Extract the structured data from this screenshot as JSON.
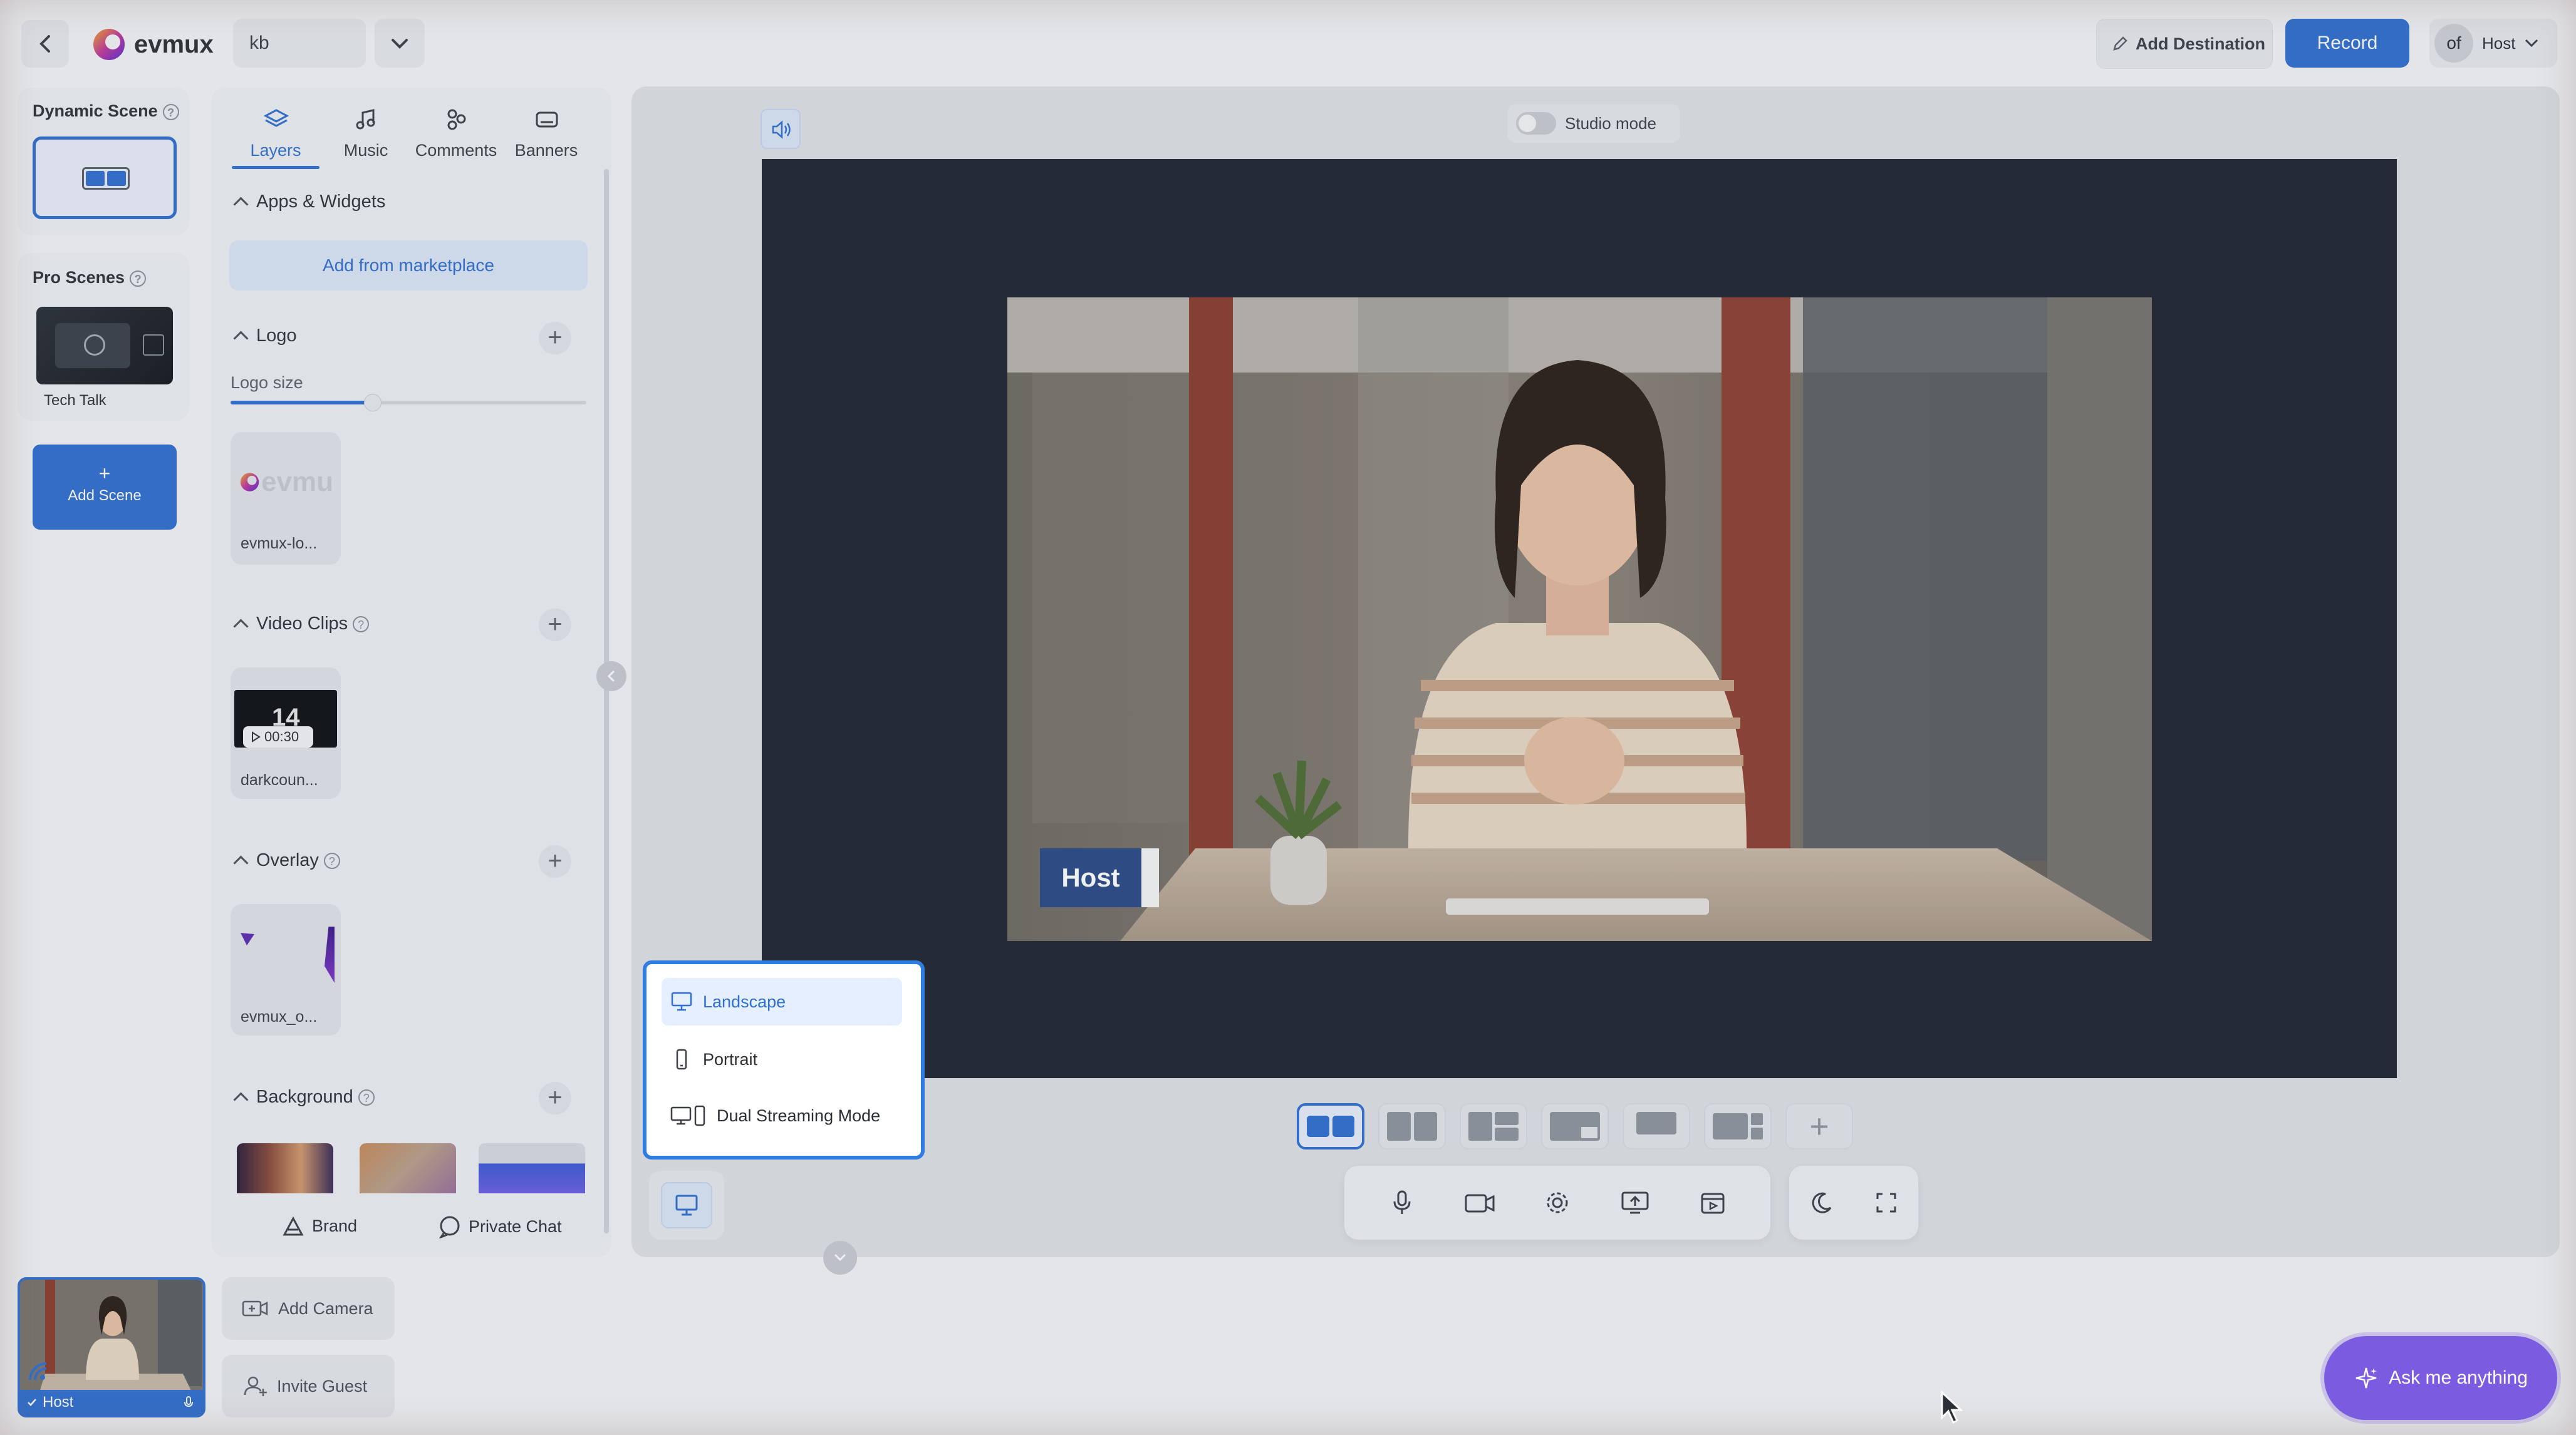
{
  "topbar": {
    "brand": "evmux",
    "project_value": "kb",
    "add_destination_label": "Add Destination",
    "record_label": "Record",
    "avatar_text": "of",
    "user_label": "Host"
  },
  "scenes": {
    "dynamic_title": "Dynamic Scene",
    "pro_title": "Pro Scenes",
    "pro_scene_name": "Tech Talk",
    "add_scene_plus": "+",
    "add_scene_label": "Add Scene",
    "help_mark": "?"
  },
  "panel": {
    "tabs": [
      {
        "label": "Layers",
        "icon": "layers-icon"
      },
      {
        "label": "Music",
        "icon": "music-icon"
      },
      {
        "label": "Comments",
        "icon": "comments-icon"
      },
      {
        "label": "Banners",
        "icon": "banners-icon"
      }
    ],
    "apps_title": "Apps & Widgets",
    "add_marketplace_label": "Add from marketplace",
    "logo_title": "Logo",
    "logo_size_label": "Logo size",
    "logo_size_value": 0.4,
    "logo_thumb_text": "evmu",
    "logo_caption": "evmux-lo...",
    "video_clips_title": "Video Clips",
    "clip_number": "14",
    "clip_duration": "00:30",
    "clip_caption": "darkcoun...",
    "overlay_title": "Overlay",
    "overlay_caption": "evmux_o...",
    "background_title": "Background",
    "plus": "+",
    "brand_label": "Brand",
    "private_chat_label": "Private Chat"
  },
  "stage": {
    "studio_mode_label": "Studio mode",
    "name_tag": "Host"
  },
  "orientation_menu": {
    "items": [
      {
        "label": "Landscape",
        "icon": "monitor-icon",
        "selected": true
      },
      {
        "label": "Portrait",
        "icon": "phone-icon",
        "selected": false
      },
      {
        "label": "Dual Streaming Mode",
        "icon": "dual-screen-icon",
        "selected": false
      }
    ]
  },
  "bottom": {
    "self_view_label": "Host",
    "add_camera_label": "Add Camera",
    "invite_guest_label": "Invite Guest",
    "ask_label": "Ask me anything"
  },
  "colors": {
    "accent": "#2f6fd0",
    "dropdown_border": "#2f7de1",
    "ask_bg": "#7b5be0"
  }
}
